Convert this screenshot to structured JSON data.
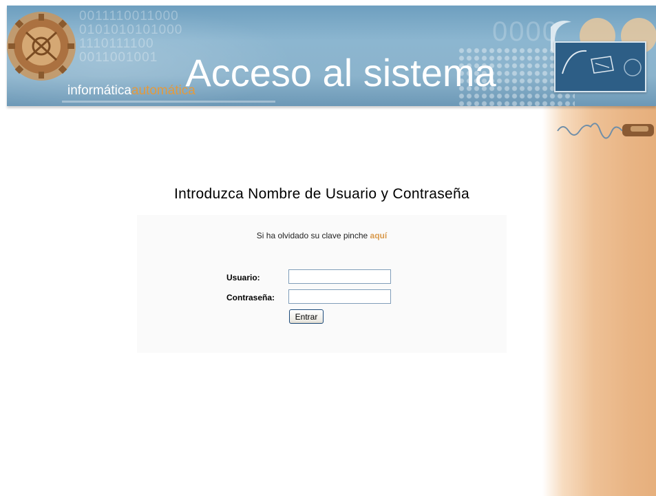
{
  "header": {
    "title": "Acceso al sistema",
    "brand_part1": "informática",
    "brand_part2": "automática",
    "digits_line1": "0011110011000",
    "digits_line2": "0101010101000",
    "digits_line3": "1110111100",
    "digits_line4": "0011001001",
    "deco_zeros": "0000"
  },
  "login": {
    "heading": "Introduzca Nombre de Usuario y Contraseña",
    "forgot_text": "Si ha olvidado su clave pinche",
    "forgot_link": "aquí",
    "username_label": "Usuario:",
    "password_label": "Contraseña:",
    "username_value": "",
    "password_value": "",
    "submit_label": "Entrar"
  },
  "colors": {
    "banner_blue": "#8cb6d0",
    "brand_orange": "#e39a3e",
    "link_orange": "#d99a4d",
    "side_strip": "#e9b585"
  }
}
